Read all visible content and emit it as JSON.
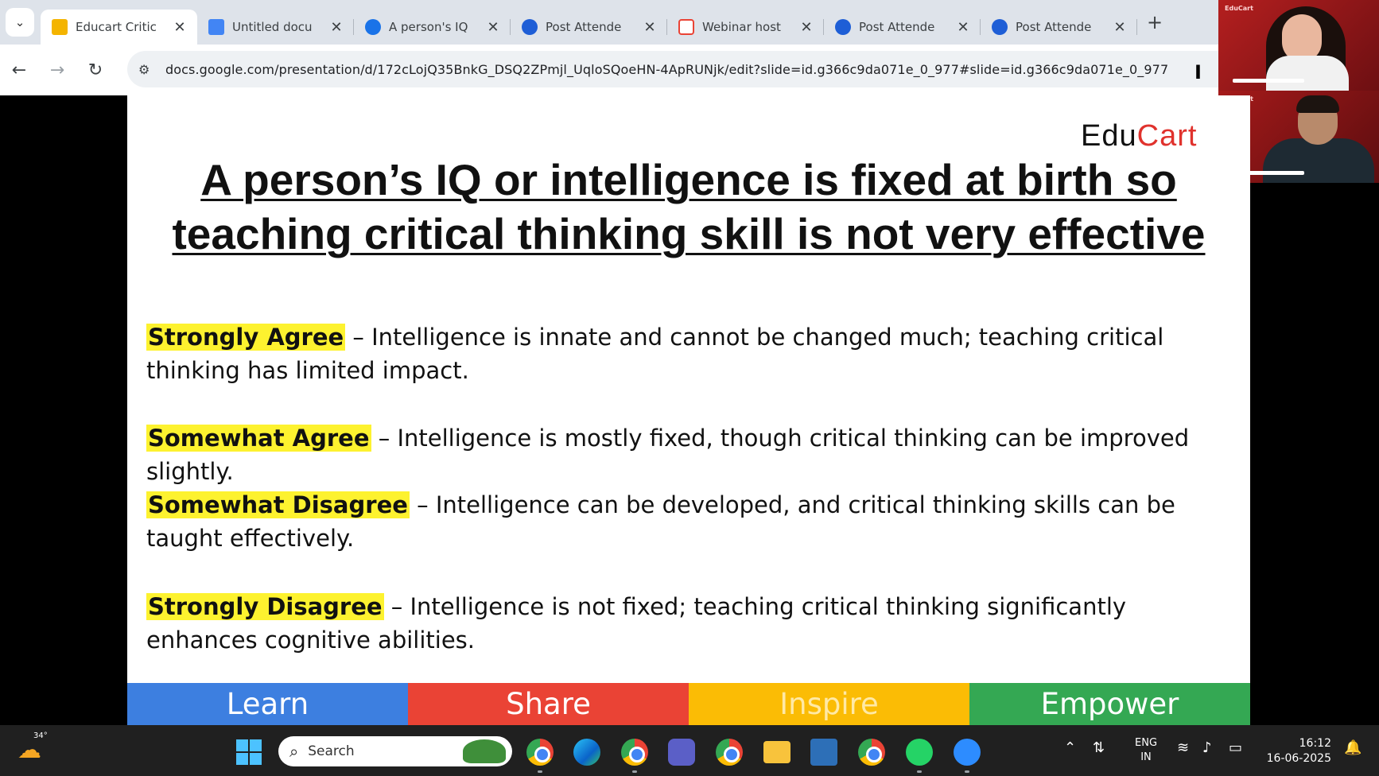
{
  "browser": {
    "tabs": [
      {
        "label": "Educart Critic",
        "icon": "slides-icon",
        "active": true
      },
      {
        "label": "Untitled docu",
        "icon": "docs-icon",
        "active": false
      },
      {
        "label": "A person's IQ",
        "icon": "internet-archive-icon",
        "active": false
      },
      {
        "label": "Post Attende",
        "icon": "zoom-icon",
        "active": false
      },
      {
        "label": "Webinar host",
        "icon": "gmail-icon",
        "active": false
      },
      {
        "label": "Post Attende",
        "icon": "zoom-icon",
        "active": false
      },
      {
        "label": "Post Attende",
        "icon": "zoom-icon",
        "active": false
      }
    ],
    "new_tab_glyph": "+",
    "close_glyph": "✕",
    "url": "docs.google.com/presentation/d/172cLojQ35BnkG_DSQ2ZPmjl_UqloSQoeHN-4ApRUNjk/edit?slide=id.g366c9da071e_0_977#slide=id.g366c9da071e_0_977"
  },
  "video": {
    "logo": "EduCart"
  },
  "slide": {
    "logo_main": "Edu",
    "logo_cart": "Cart",
    "title": "A person’s IQ or intelligence is fixed at birth so teaching critical thinking skill is not very effective",
    "options": [
      {
        "label": "Strongly Agree",
        "text": " – Intelligence is innate and cannot be changed much; teaching critical thinking has limited impact."
      },
      {
        "label": "Somewhat Agree",
        "text": " – Intelligence is mostly fixed, though critical thinking can be improved slightly."
      },
      {
        "label": "Somewhat Disagree",
        "text": " – Intelligence can be developed, and critical thinking skills can be taught effectively."
      },
      {
        "label": "Strongly Disagree",
        "text": " – Intelligence is not fixed; teaching critical thinking significantly enhances cognitive abilities."
      }
    ],
    "banner": [
      "Learn",
      "Share",
      "Inspire",
      "Empower"
    ],
    "highlight_color": "#fdf22f"
  },
  "taskbar": {
    "weather_temp": "34°",
    "search_label": "Search",
    "language": "ENG",
    "region": "IN",
    "time": "16:12",
    "date": "16-06-2025"
  }
}
